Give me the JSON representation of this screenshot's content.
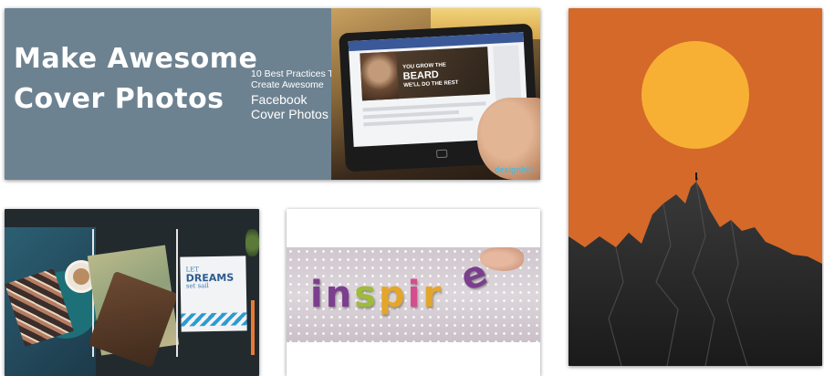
{
  "gallery": {
    "banner_card": {
      "headline_line1": "Make Awesome",
      "headline_line2": "Cover Photos",
      "subtitle_line1": "10 Best Practices To",
      "subtitle_line2": "Create Awesome",
      "subtitle_line3": "Facebook",
      "subtitle_line4": "Cover Photos",
      "fb_cover_small": "YOU GROW THE",
      "fb_cover_big": "BEARD",
      "fb_cover_tail": "WE'LL DO THE REST",
      "watermark": "designhill"
    },
    "journal_card": {
      "notebook_line1": "LET",
      "notebook_line2": "DREAMS",
      "notebook_line3": "set sail"
    },
    "inspire_card": {
      "letters": [
        "i",
        "n",
        "s",
        "p",
        "i",
        "r"
      ],
      "last_letter": "e"
    }
  },
  "colors": {
    "banner_bg": "#6d8291",
    "mountain_bg": "#d4692a",
    "sun": "#f7b033",
    "facebook_blue": "#3b5998"
  }
}
